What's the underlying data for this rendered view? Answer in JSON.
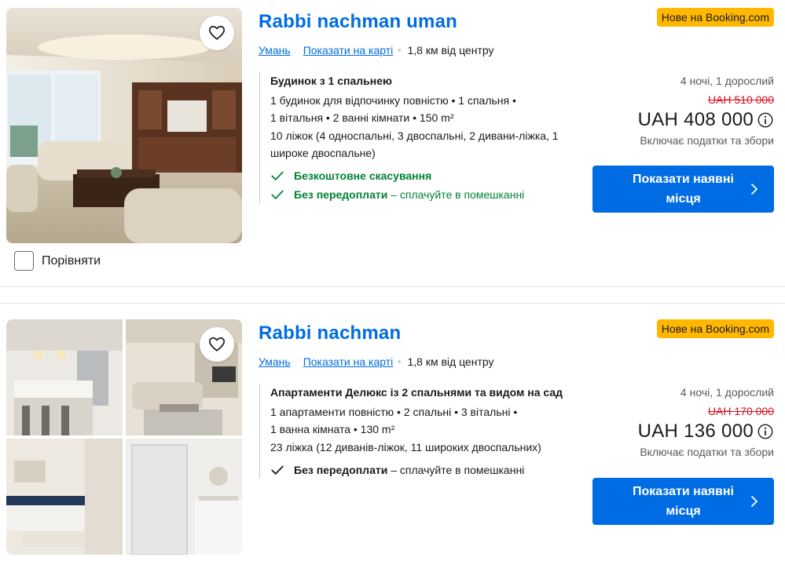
{
  "listings": [
    {
      "title": "Rabbi nachman uman",
      "badge": "Нове на Booking.com",
      "city": "Умань",
      "map_link": "Показати на карті",
      "distance": "1,8 км від центру",
      "unit_name": "Будинок з 1 спальнею",
      "unit_desc_1": "1 будинок для відпочинку повністю • 1 спальня •",
      "unit_desc_2": "1 вітальня • 2 ванні кімнати • 150 m²",
      "beds": "10 ліжок (4 односпальні, 3 двоспальні, 2 дивани-ліжка, 1 широке двоспальне)",
      "benefit_1": "Безкоштовне скасування",
      "benefit_2_bold": "Без передоплати",
      "benefit_2_rest": " – сплачуйте в помешканні",
      "stay": "4 ночі, 1 дорослий",
      "old_price": "UAH 510 000",
      "price": "UAH 408 000",
      "taxes": "Включає податки та збори",
      "cta": "Показати наявні місця",
      "compare": "Порівняти"
    },
    {
      "title": "Rabbi nachman",
      "badge": "Нове на Booking.com",
      "city": "Умань",
      "map_link": "Показати на карті",
      "distance": "1,8 км від центру",
      "unit_name": "Апартаменти Делюкс із 2 спальнями та видом на сад",
      "unit_desc_1": "1 апартаменти повністю • 2 спальні • 3 вітальні •",
      "unit_desc_2": "1 ванна кімната • 130 m²",
      "beds": "23 ліжка (12 диванів-ліжок, 11 широких двоспальних)",
      "benefit_1_bold": "Без передоплати",
      "benefit_1_rest": " – сплачуйте в помешканні",
      "stay": "4 ночі, 1 дорослий",
      "old_price": "UAH 170 000",
      "price": "UAH 136 000",
      "taxes": "Включає податки та збори",
      "cta": "Показати наявні місця"
    }
  ],
  "colors": {
    "link": "#006ce4",
    "badge": "#ffb700",
    "strike": "#d4111e",
    "green": "#008234",
    "button": "#006ce4"
  },
  "icons": [
    "heart-icon",
    "check-icon",
    "info-icon",
    "chevron-right-icon"
  ]
}
